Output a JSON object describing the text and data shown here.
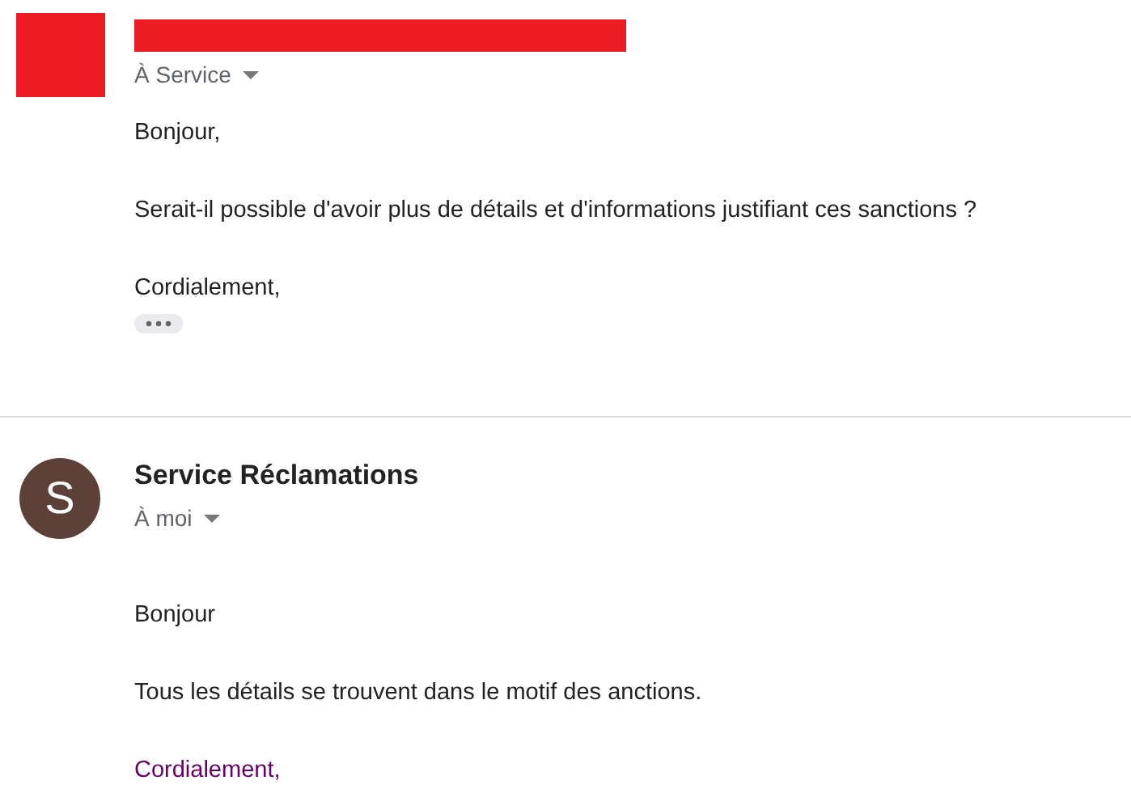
{
  "messages": [
    {
      "redacted": true,
      "recipient": "À Service",
      "paragraphs": [
        {
          "text": "Bonjour,"
        },
        {
          "text": "Serait-il possible d'avoir plus de détails et d'informations justifiant ces sanctions ?"
        },
        {
          "text": "Cordialement,"
        }
      ],
      "trimmed_content": true
    },
    {
      "redacted": false,
      "avatar_letter": "S",
      "sender": "Service Réclamations",
      "recipient": "À moi",
      "paragraphs": [
        {
          "text": "Bonjour"
        },
        {
          "text": "Tous les détails se trouvent dans le motif des anctions."
        },
        {
          "text": "Cordialement,",
          "color": "#660066"
        }
      ],
      "trimmed_content": false
    }
  ]
}
